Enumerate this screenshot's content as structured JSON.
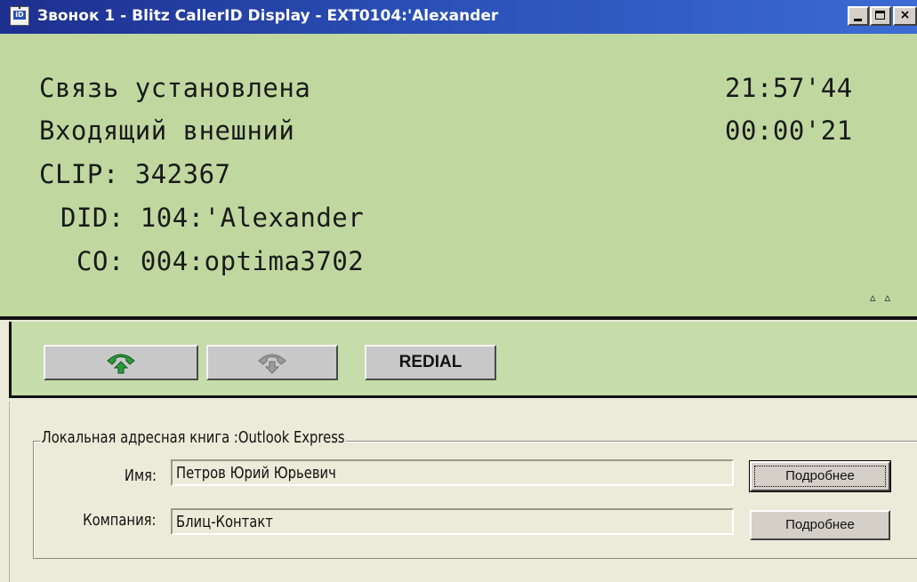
{
  "window": {
    "title": "Звонок 1 - Blitz CallerID Display - EXT0104:'Alexander",
    "icon": "callerid-app-icon",
    "controls": {
      "minimize": "minimize-icon",
      "maximize": "maximize-icon",
      "close": "×"
    }
  },
  "display": {
    "status": "Связь установлена",
    "direction": "Входящий внешний",
    "clock": "21:57'44",
    "duration": "00:00'21",
    "clip": "CLIP: 342367",
    "did": "DID: 104:'Alexander",
    "co": "CO: 004:optima3702",
    "scroll_arrows": "▵▵",
    "colors": {
      "background": "#c0d8a0",
      "text": "#1a1a1a"
    }
  },
  "buttons": {
    "answer_icon": "phone-answer-icon",
    "hangup_icon": "phone-hangup-icon",
    "redial": "REDIAL"
  },
  "address_book": {
    "legend": "Локальная адресная книга :Outlook Express",
    "name_label": "Имя:",
    "name_value": "Петров Юрий Юрьевич",
    "company_label": "Компания:",
    "company_value": "Блиц-Контакт",
    "details_button_1": "Подробнее",
    "details_button_2": "Подробнее"
  }
}
